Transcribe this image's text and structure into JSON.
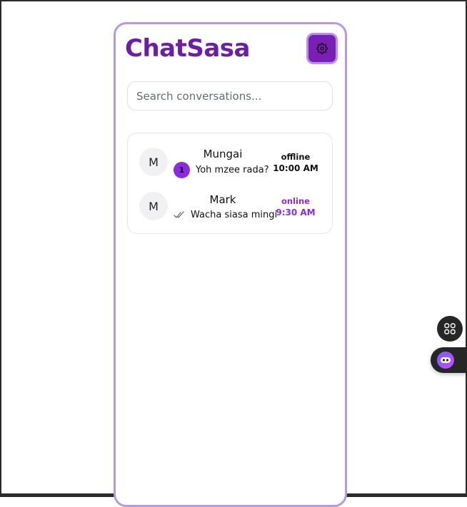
{
  "app": {
    "title": "ChatSasa",
    "settings_icon": "gear-icon"
  },
  "search": {
    "placeholder": "Search conversations...",
    "value": ""
  },
  "chats": [
    {
      "avatar": "M",
      "name": "Mungai",
      "preview": "Yoh mzee rada?",
      "unread": "1",
      "status": "offline",
      "time": "10:00 AM",
      "status_color": "#111111"
    },
    {
      "avatar": "M",
      "name": "Mark",
      "preview": "Wacha siasa mingi",
      "receipt_icon": "double-check-icon",
      "status": "online",
      "time": "9:30 AM",
      "status_color": "#8a2be2"
    }
  ],
  "floating": {
    "apps_icon": "grid-icon",
    "assistant_icon": "bot-icon"
  },
  "colors": {
    "brand": "#6b1fa6",
    "accent": "#8a2be2",
    "border": "#b697ea"
  }
}
